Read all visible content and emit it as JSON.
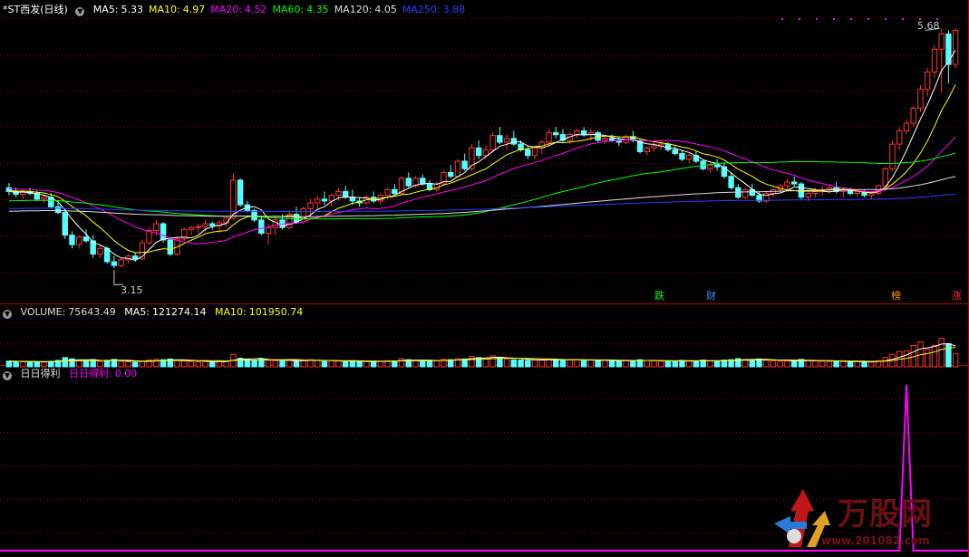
{
  "window": {
    "title": "*ST西发(日线)"
  },
  "main_panel": {
    "ma": [
      {
        "label": "MA5:",
        "value": "5.33",
        "color": "#ffffff"
      },
      {
        "label": "MA10:",
        "value": "4.97",
        "color": "#ffff00"
      },
      {
        "label": "MA20:",
        "value": "4.52",
        "color": "#ff00ff"
      },
      {
        "label": "MA60:",
        "value": "4.35",
        "color": "#00ff00"
      },
      {
        "label": "MA120:",
        "value": "4.05",
        "color": "#dcdcdc"
      },
      {
        "label": "MA250:",
        "value": "3.88",
        "color": "#2b3cff"
      }
    ],
    "high_label": "5.68",
    "low_label": "3.15",
    "event_tags": [
      {
        "text": "跌",
        "color": "#00ff00"
      },
      {
        "text": "财",
        "color": "#3c8cff"
      },
      {
        "text": "榜",
        "color": "#ff9a00"
      },
      {
        "text": "涨",
        "color": "#ff3030"
      }
    ]
  },
  "volume_panel": {
    "title": "VOLUME:",
    "value": "75643.49",
    "ma5_label": "MA5:",
    "ma5": "121274.14",
    "ma10_label": "MA10:",
    "ma10": "101950.74"
  },
  "indicator_panel": {
    "title": "日日得利",
    "series_label": "日日得利:",
    "value": "0.00"
  },
  "watermark": {
    "brand": "万股网",
    "url": "www.201082.com"
  },
  "colors": {
    "up": "#ff3232",
    "down": "#54ffff",
    "grid": "#7a0000",
    "frame": "#b00000",
    "indicator": "#ff00ff"
  },
  "chart_data": [
    {
      "type": "candlestick",
      "title": "*ST西发(日线)",
      "ylim": [
        3.0,
        5.75
      ],
      "annotations": {
        "max": 5.68,
        "min": 3.15
      },
      "ohlc": [
        [
          4.0,
          4.05,
          3.92,
          3.96
        ],
        [
          3.96,
          4.0,
          3.9,
          3.93
        ],
        [
          3.93,
          3.98,
          3.88,
          3.96
        ],
        [
          3.96,
          4.0,
          3.92,
          3.94
        ],
        [
          3.94,
          3.97,
          3.86,
          3.88
        ],
        [
          3.88,
          3.92,
          3.84,
          3.9
        ],
        [
          3.9,
          3.94,
          3.78,
          3.8
        ],
        [
          3.8,
          3.84,
          3.72,
          3.74
        ],
        [
          3.74,
          3.78,
          3.46,
          3.5
        ],
        [
          3.5,
          3.54,
          3.36,
          3.4
        ],
        [
          3.4,
          3.5,
          3.36,
          3.48
        ],
        [
          3.48,
          3.56,
          3.42,
          3.44
        ],
        [
          3.44,
          3.5,
          3.26,
          3.3
        ],
        [
          3.3,
          3.4,
          3.26,
          3.36
        ],
        [
          3.36,
          3.38,
          3.2,
          3.22
        ],
        [
          3.22,
          3.28,
          3.15,
          3.18
        ],
        [
          3.18,
          3.26,
          3.16,
          3.24
        ],
        [
          3.24,
          3.3,
          3.2,
          3.28
        ],
        [
          3.28,
          3.32,
          3.22,
          3.25
        ],
        [
          3.25,
          3.45,
          3.24,
          3.42
        ],
        [
          3.42,
          3.58,
          3.4,
          3.55
        ],
        [
          3.55,
          3.66,
          3.5,
          3.62
        ],
        [
          3.62,
          3.64,
          3.42,
          3.45
        ],
        [
          3.45,
          3.48,
          3.28,
          3.3
        ],
        [
          3.3,
          3.48,
          3.28,
          3.46
        ],
        [
          3.46,
          3.58,
          3.44,
          3.56
        ],
        [
          3.56,
          3.6,
          3.5,
          3.58
        ],
        [
          3.58,
          3.62,
          3.52,
          3.59
        ],
        [
          3.59,
          3.66,
          3.54,
          3.62
        ],
        [
          3.62,
          3.64,
          3.56,
          3.6
        ],
        [
          3.6,
          3.66,
          3.52,
          3.63
        ],
        [
          3.63,
          3.7,
          3.58,
          3.68
        ],
        [
          3.68,
          4.15,
          3.66,
          4.08
        ],
        [
          4.08,
          4.1,
          3.8,
          3.82
        ],
        [
          3.82,
          3.86,
          3.74,
          3.76
        ],
        [
          3.76,
          3.78,
          3.64,
          3.66
        ],
        [
          3.66,
          3.7,
          3.5,
          3.52
        ],
        [
          3.52,
          3.62,
          3.4,
          3.58
        ],
        [
          3.58,
          3.7,
          3.5,
          3.66
        ],
        [
          3.66,
          3.72,
          3.56,
          3.58
        ],
        [
          3.58,
          3.76,
          3.56,
          3.72
        ],
        [
          3.72,
          3.8,
          3.62,
          3.64
        ],
        [
          3.64,
          3.8,
          3.62,
          3.78
        ],
        [
          3.78,
          3.88,
          3.7,
          3.84
        ],
        [
          3.84,
          3.92,
          3.78,
          3.88
        ],
        [
          3.88,
          3.96,
          3.82,
          3.86
        ],
        [
          3.86,
          3.94,
          3.8,
          3.92
        ],
        [
          3.92,
          4.0,
          3.86,
          3.96
        ],
        [
          3.96,
          4.02,
          3.88,
          3.9
        ],
        [
          3.9,
          3.98,
          3.82,
          3.86
        ],
        [
          3.86,
          3.9,
          3.8,
          3.84
        ],
        [
          3.84,
          3.92,
          3.82,
          3.9
        ],
        [
          3.9,
          3.96,
          3.84,
          3.86
        ],
        [
          3.86,
          3.94,
          3.82,
          3.92
        ],
        [
          3.92,
          4.0,
          3.88,
          3.98
        ],
        [
          3.98,
          4.04,
          3.92,
          3.94
        ],
        [
          3.94,
          4.12,
          3.92,
          4.1
        ],
        [
          4.1,
          4.16,
          4.0,
          4.02
        ],
        [
          4.02,
          4.12,
          4.0,
          4.1
        ],
        [
          4.1,
          4.14,
          4.02,
          4.04
        ],
        [
          4.04,
          4.08,
          3.96,
          3.98
        ],
        [
          3.98,
          4.06,
          3.96,
          4.04
        ],
        [
          4.04,
          4.18,
          4.02,
          4.16
        ],
        [
          4.16,
          4.24,
          4.1,
          4.12
        ],
        [
          4.12,
          4.3,
          4.1,
          4.28
        ],
        [
          4.28,
          4.36,
          4.18,
          4.2
        ],
        [
          4.2,
          4.46,
          4.18,
          4.42
        ],
        [
          4.42,
          4.5,
          4.3,
          4.34
        ],
        [
          4.34,
          4.44,
          4.3,
          4.4
        ],
        [
          4.4,
          4.58,
          4.38,
          4.55
        ],
        [
          4.55,
          4.64,
          4.46,
          4.48
        ],
        [
          4.48,
          4.56,
          4.4,
          4.52
        ],
        [
          4.52,
          4.6,
          4.44,
          4.46
        ],
        [
          4.46,
          4.5,
          4.38,
          4.4
        ],
        [
          4.4,
          4.44,
          4.3,
          4.34
        ],
        [
          4.34,
          4.44,
          4.3,
          4.42
        ],
        [
          4.42,
          4.5,
          4.36,
          4.48
        ],
        [
          4.48,
          4.62,
          4.44,
          4.58
        ],
        [
          4.58,
          4.64,
          4.52,
          4.56
        ],
        [
          4.56,
          4.62,
          4.48,
          4.5
        ],
        [
          4.5,
          4.58,
          4.46,
          4.56
        ],
        [
          4.56,
          4.62,
          4.52,
          4.6
        ],
        [
          4.6,
          4.64,
          4.54,
          4.56
        ],
        [
          4.56,
          4.62,
          4.5,
          4.58
        ],
        [
          4.58,
          4.6,
          4.48,
          4.5
        ],
        [
          4.5,
          4.54,
          4.46,
          4.52
        ],
        [
          4.52,
          4.56,
          4.48,
          4.5
        ],
        [
          4.5,
          4.54,
          4.44,
          4.48
        ],
        [
          4.48,
          4.56,
          4.46,
          4.54
        ],
        [
          4.54,
          4.6,
          4.48,
          4.5
        ],
        [
          4.5,
          4.52,
          4.36,
          4.38
        ],
        [
          4.38,
          4.44,
          4.34,
          4.42
        ],
        [
          4.42,
          4.48,
          4.38,
          4.44
        ],
        [
          4.44,
          4.5,
          4.4,
          4.46
        ],
        [
          4.46,
          4.48,
          4.38,
          4.4
        ],
        [
          4.4,
          4.44,
          4.34,
          4.36
        ],
        [
          4.36,
          4.4,
          4.28,
          4.3
        ],
        [
          4.3,
          4.36,
          4.26,
          4.34
        ],
        [
          4.34,
          4.38,
          4.26,
          4.28
        ],
        [
          4.28,
          4.3,
          4.18,
          4.2
        ],
        [
          4.2,
          4.26,
          4.16,
          4.24
        ],
        [
          4.24,
          4.3,
          4.18,
          4.22
        ],
        [
          4.22,
          4.26,
          4.1,
          4.12
        ],
        [
          4.12,
          4.16,
          3.98,
          4.0
        ],
        [
          4.0,
          4.04,
          3.88,
          3.9
        ],
        [
          3.9,
          4.0,
          3.88,
          3.98
        ],
        [
          3.98,
          4.04,
          3.9,
          3.92
        ],
        [
          3.92,
          3.96,
          3.84,
          3.86
        ],
        [
          3.86,
          3.96,
          3.84,
          3.94
        ],
        [
          3.94,
          4.0,
          3.9,
          3.98
        ],
        [
          3.98,
          4.04,
          3.94,
          4.02
        ],
        [
          4.02,
          4.1,
          3.98,
          4.06
        ],
        [
          4.06,
          4.12,
          4.02,
          4.04
        ],
        [
          4.04,
          4.06,
          3.88,
          3.9
        ],
        [
          3.9,
          3.96,
          3.86,
          3.94
        ],
        [
          3.94,
          4.0,
          3.9,
          3.96
        ],
        [
          3.96,
          4.02,
          3.92,
          3.98
        ],
        [
          3.98,
          4.04,
          3.94,
          4.0
        ],
        [
          4.0,
          4.06,
          3.94,
          3.96
        ],
        [
          3.96,
          4.0,
          3.9,
          3.98
        ],
        [
          3.98,
          4.0,
          3.92,
          3.94
        ],
        [
          3.94,
          3.98,
          3.9,
          3.96
        ],
        [
          3.96,
          3.98,
          3.9,
          3.92
        ],
        [
          3.92,
          3.96,
          3.88,
          3.94
        ],
        [
          3.94,
          4.04,
          3.92,
          4.02
        ],
        [
          4.02,
          4.22,
          4.0,
          4.2
        ],
        [
          4.2,
          4.5,
          4.18,
          4.46
        ],
        [
          4.46,
          4.64,
          4.4,
          4.6
        ],
        [
          4.6,
          4.72,
          4.56,
          4.68
        ],
        [
          4.68,
          4.86,
          4.64,
          4.84
        ],
        [
          4.84,
          5.08,
          4.8,
          5.04
        ],
        [
          5.04,
          5.26,
          4.96,
          5.22
        ],
        [
          5.22,
          5.5,
          5.16,
          5.46
        ],
        [
          5.46,
          5.68,
          5.0,
          5.62
        ],
        [
          5.62,
          5.66,
          5.1,
          5.3
        ],
        [
          5.3,
          5.68,
          5.26,
          5.66
        ]
      ],
      "series": [
        {
          "name": "MA5",
          "color": "#ffffff"
        },
        {
          "name": "MA10",
          "color": "#ffff00"
        },
        {
          "name": "MA20",
          "color": "#ff00ff"
        },
        {
          "name": "MA60",
          "color": "#00ff00"
        },
        {
          "name": "MA120",
          "color": "#dcdcdc"
        },
        {
          "name": "MA250",
          "color": "#2b3cff"
        }
      ]
    },
    {
      "type": "bar",
      "title": "VOLUME",
      "ylim": [
        0,
        260000
      ],
      "values": [
        32000,
        30000,
        28000,
        30000,
        27000,
        26000,
        31000,
        36000,
        52000,
        45000,
        34000,
        32000,
        40000,
        30000,
        36000,
        42000,
        30000,
        28000,
        26000,
        30000,
        38000,
        42000,
        40000,
        44000,
        36000,
        34000,
        30000,
        28000,
        30000,
        27000,
        30000,
        32000,
        70000,
        48000,
        40000,
        38000,
        44000,
        36000,
        34000,
        32000,
        36000,
        34000,
        38000,
        40000,
        36000,
        30000,
        34000,
        32000,
        30000,
        34000,
        28000,
        30000,
        32000,
        30000,
        34000,
        33000,
        46000,
        40000,
        36000,
        34000,
        32000,
        34000,
        42000,
        40000,
        46000,
        44000,
        58000,
        52000,
        48000,
        62000,
        50000,
        44000,
        40000,
        38000,
        36000,
        38000,
        40000,
        44000,
        42000,
        40000,
        38000,
        40000,
        36000,
        38000,
        34000,
        36000,
        34000,
        32000,
        36000,
        34000,
        40000,
        36000,
        34000,
        32000,
        30000,
        32000,
        36000,
        34000,
        32000,
        38000,
        34000,
        32000,
        38000,
        40000,
        46000,
        42000,
        40000,
        44000,
        36000,
        34000,
        32000,
        34000,
        30000,
        42000,
        36000,
        34000,
        32000,
        30000,
        32000,
        30000,
        28000,
        30000,
        28000,
        26000,
        34000,
        52000,
        70000,
        86000,
        90000,
        120000,
        140000,
        100000,
        120000,
        160000,
        130000,
        75643
      ]
    },
    {
      "type": "line",
      "title": "日日得利",
      "ylim": [
        0,
        1
      ],
      "spike_at_index": 128,
      "values": "zero except one bar"
    }
  ]
}
